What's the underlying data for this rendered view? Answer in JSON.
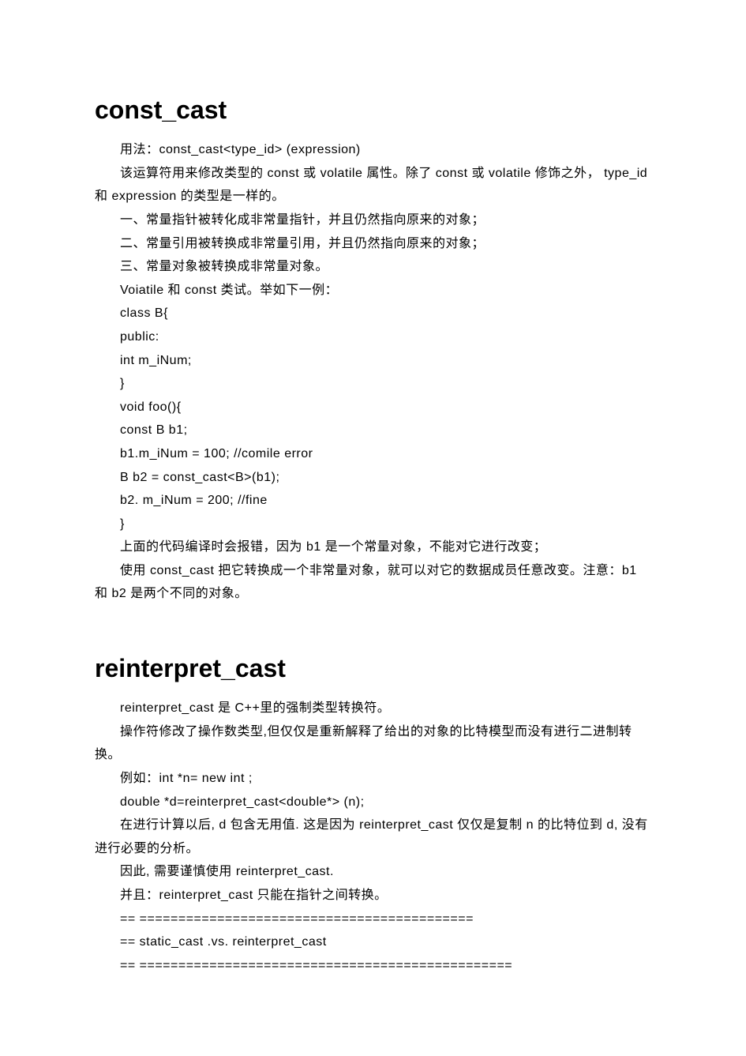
{
  "section1": {
    "title": "const_cast",
    "lines": [
      "用法：const_cast<type_id> (expression)",
      "该运算符用来修改类型的 const 或 volatile 属性。除了 const  或 volatile 修饰之外，  type_id 和 expression 的类型是一样的。",
      "一、常量指针被转化成非常量指针，并且仍然指向原来的对象；",
      "二、常量引用被转换成非常量引用，并且仍然指向原来的对象；",
      "三、常量对象被转换成非常量对象。",
      "Voiatile 和 const 类试。举如下一例：",
      "class  B{",
      "public:",
      "int  m_iNum;",
      "}",
      "void  foo(){",
      "const  B  b1;",
      "b1.m_iNum = 100;  //comile  error",
      "B  b2 =  const_cast<B>(b1);",
      "b2. m_iNum =  200;  //fine",
      "}",
      "上面的代码编译时会报错，因为 b1 是一个常量对象，不能对它进行改变；",
      "使用 const_cast 把它转换成一个非常量对象，就可以对它的数据成员任意改变。注意：b1 和 b2 是两个不同的对象。"
    ]
  },
  "section2": {
    "title": "reinterpret_cast",
    "lines": [
      "reinterpret_cast 是 C++里的强制类型转换符。",
      "操作符修改了操作数类型,但仅仅是重新解释了给出的对象的比特模型而没有进行二进制转换。",
      "例如：int *n= new int ;",
      "double *d=reinterpret_cast<double*> (n);",
      "在进行计算以后, d 包含无用值. 这是因为 reinterpret_cast 仅仅是复制 n 的比特位到 d, 没有进行必要的分析。",
      "因此, 需要谨慎使用 reinterpret_cast.",
      "并且：reinterpret_cast 只能在指针之间转换。",
      "==  ===========================================",
      "==  static_cast .vs.  reinterpret_cast",
      "==  ================================================"
    ]
  }
}
